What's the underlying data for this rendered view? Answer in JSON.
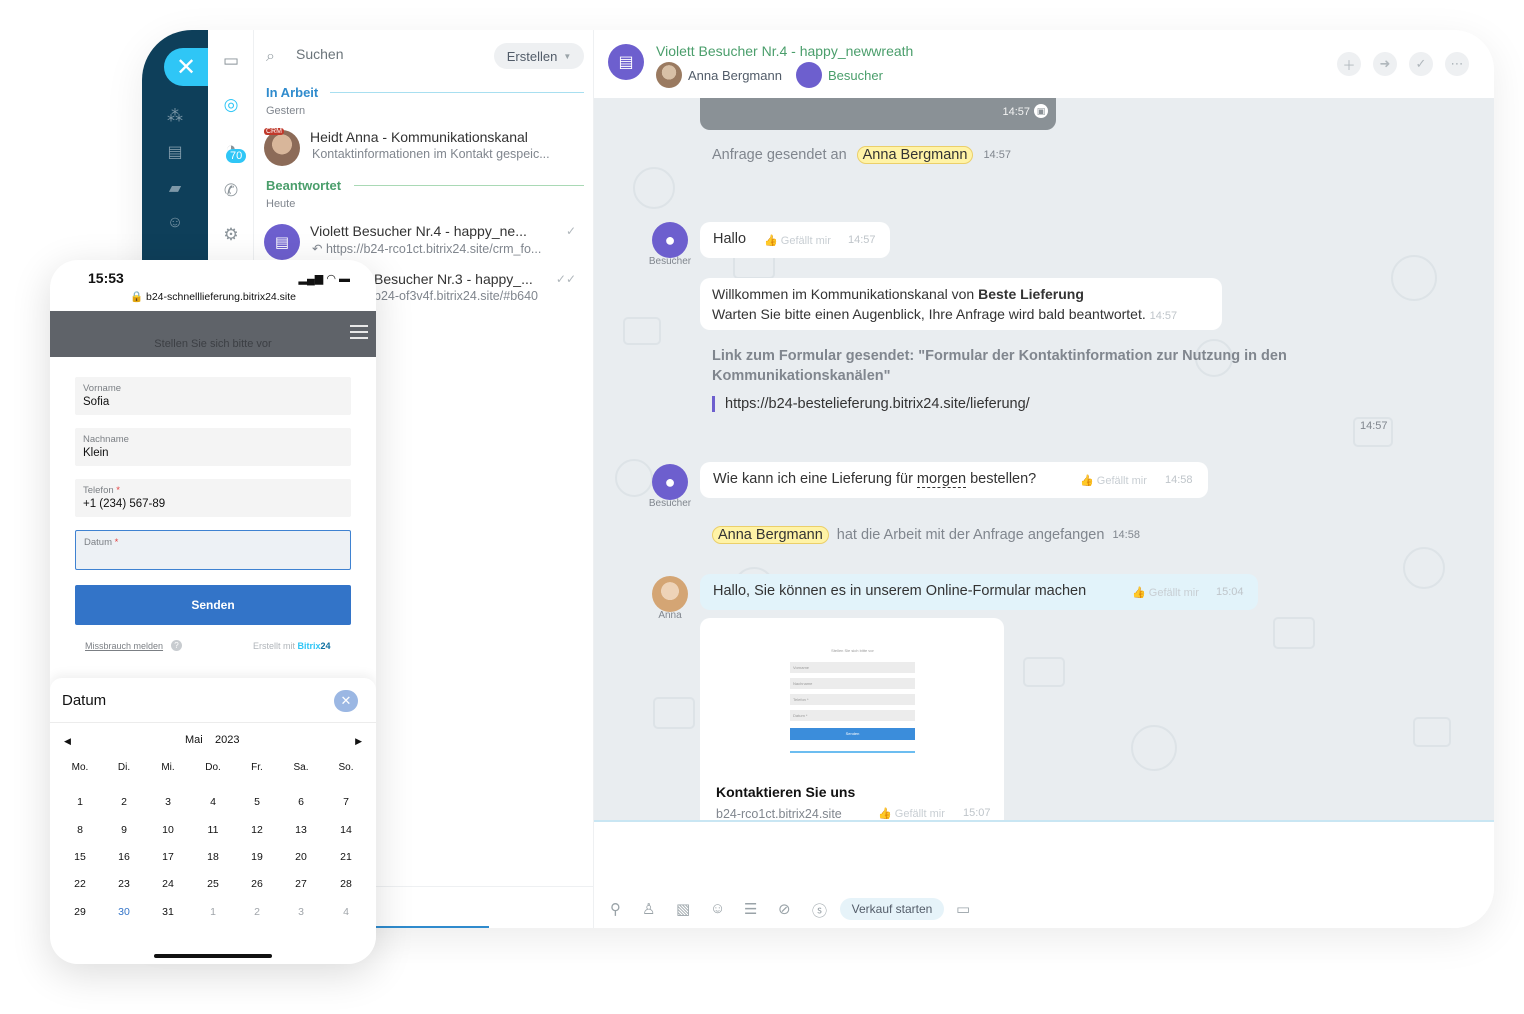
{
  "desktop": {
    "rail": {
      "close_icon": "close-icon"
    },
    "icon_col": {
      "badge": "70"
    },
    "list": {
      "search_placeholder": "Suchen",
      "create_label": "Erstellen",
      "groups": [
        {
          "title": "In Arbeit",
          "sub": "Gestern"
        },
        {
          "title": "Beantwortet",
          "sub": "Heute"
        }
      ],
      "items": [
        {
          "title": "Heidt Anna - Kommunikationskanal",
          "preview": "Kontaktinformationen im Kontakt gespeic...",
          "tag": "CRM"
        },
        {
          "title": "Violett Besucher Nr.4 - happy_ne...",
          "preview": "https://b24-rco1ct.bitrix24.site/crm_fo..."
        },
        {
          "title": "Besucher Nr.3 - happy_...",
          "preview": "b24-of3v4f.bitrix24.site/#b640"
        }
      ]
    },
    "chat": {
      "title": "Violett Besucher Nr.4 - happy_newwreath",
      "user1": "Anna Bergmann",
      "user2": "Besucher",
      "top_time": "14:57",
      "sys1": {
        "prefix": "Anfrage gesendet an",
        "name": "Anna Bergmann",
        "time": "14:57"
      },
      "msg_hallo": {
        "text": "Hallo",
        "likes": "Gefällt mir",
        "time": "14:57",
        "author": "Besucher"
      },
      "msg_welcome": {
        "line1_a": "Willkommen im Kommunikationskanal von ",
        "line1_b": "Beste Lieferung",
        "line2": "Warten Sie bitte einen Augenblick, Ihre Anfrage wird bald beantwortet.",
        "time": "14:57"
      },
      "msg_link": {
        "text": "Link zum Formular gesendet: \"Formular der Kontaktinformation zur Nutzung in den Kommunikationskanälen\"",
        "url": "https://b24-bestelieferung.bitrix24.site/lieferung/",
        "time": "14:57"
      },
      "msg_question": {
        "text_a": "Wie kann ich eine Lieferung für ",
        "text_b": "morgen",
        "text_c": " bestellen?",
        "likes": "Gefällt mir",
        "time": "14:58",
        "author": "Besucher"
      },
      "sys2": {
        "name": "Anna Bergmann",
        "text": "hat die Arbeit mit der Anfrage angefangen",
        "time": "14:58"
      },
      "msg_answer": {
        "text": "Hallo, Sie können es in unserem Online-Formular machen",
        "likes": "Gefällt mir",
        "time": "15:04",
        "author": "Anna"
      },
      "card": {
        "title": "Kontaktieren Sie uns",
        "domain": "b24-rco1ct.bitrix24.site",
        "likes": "Gefällt mir",
        "time": "15:07",
        "preview_title": "Stellen Sie sich bitte vor",
        "preview_fields": [
          "Vorname",
          "Nachname",
          "Telefon *",
          "Datum *"
        ],
        "preview_button": "Senden"
      },
      "composer": {
        "start_sale": "Verkauf starten"
      }
    }
  },
  "phone": {
    "time": "15:53",
    "url": "b24-schnelllieferung.bitrix24.site",
    "form_title": "Stellen Sie sich bitte vor",
    "fields": [
      {
        "label": "Vorname",
        "value": "Sofia"
      },
      {
        "label": "Nachname",
        "value": "Klein"
      },
      {
        "label": "Telefon",
        "value": "+1 (234) 567-89",
        "required": "*"
      },
      {
        "label": "Datum",
        "value": "",
        "required": "*"
      }
    ],
    "submit": "Senden",
    "abuse": "Missbrauch melden",
    "made_with": "Erstellt mit",
    "brand": "Bitrix",
    "brand_num": "24",
    "date_sheet": {
      "title": "Datum",
      "month": "Mai",
      "year": "2023",
      "weekdays": [
        "Mo.",
        "Di.",
        "Mi.",
        "Do.",
        "Fr.",
        "Sa.",
        "So."
      ],
      "weeks": [
        [
          "1",
          "2",
          "3",
          "4",
          "5",
          "6",
          "7"
        ],
        [
          "8",
          "9",
          "10",
          "11",
          "12",
          "13",
          "14"
        ],
        [
          "15",
          "16",
          "17",
          "18",
          "19",
          "20",
          "21"
        ],
        [
          "22",
          "23",
          "24",
          "25",
          "26",
          "27",
          "28"
        ],
        [
          "29",
          "30",
          "31",
          "1",
          "2",
          "3",
          "4"
        ]
      ],
      "today": "30"
    }
  },
  "colors": {
    "accent": "#2fc6f6",
    "green": "#4a9e6b",
    "violet": "#6d5fce",
    "button": "#3374c8"
  }
}
